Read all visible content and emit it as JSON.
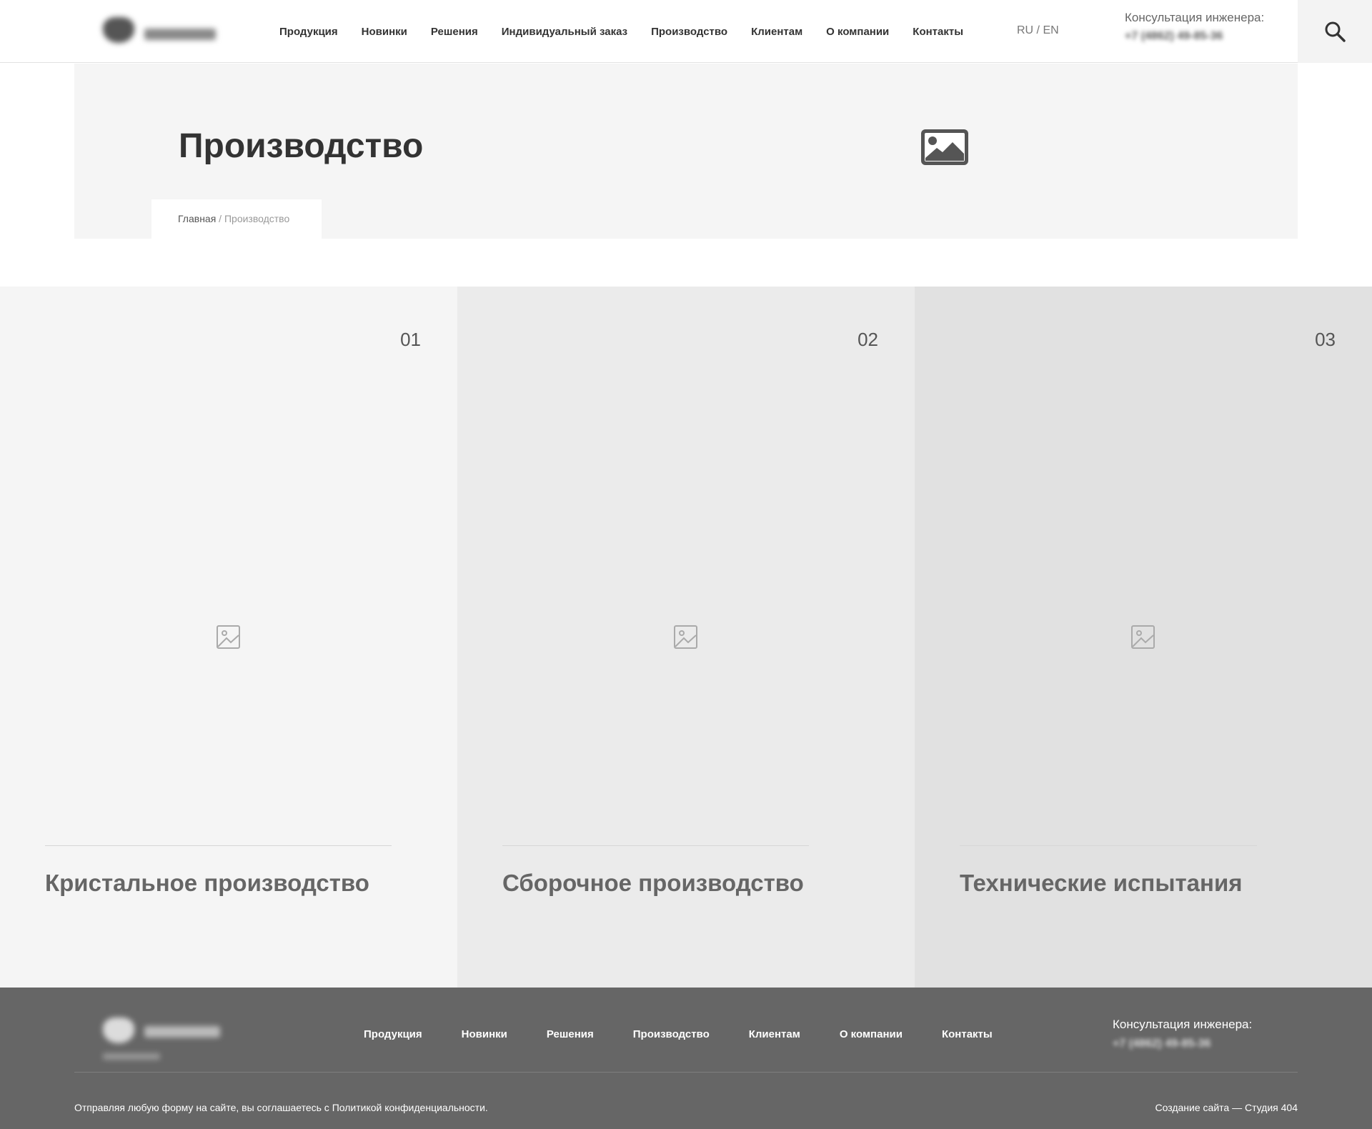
{
  "header": {
    "nav": [
      "Продукция",
      "Новинки",
      "Решения",
      "Индивидуальный заказ",
      "Производство",
      "Клиентам",
      "О компании",
      "Контакты"
    ],
    "lang": "RU / EN",
    "consult_label": "Консультация инженера:",
    "consult_phone": "+7 (4862) 49-85-36"
  },
  "hero": {
    "title": "Производство",
    "breadcrumb_home": "Главная",
    "breadcrumb_sep": " / ",
    "breadcrumb_current": "Производство"
  },
  "sections": [
    {
      "number": "01",
      "title": "Кристальное производство",
      "bg": "#f5f5f5"
    },
    {
      "number": "02",
      "title": "Сборочное производство",
      "bg": "#ebebeb"
    },
    {
      "number": "03",
      "title": "Технические испытания",
      "bg": "#e1e1e1"
    }
  ],
  "footer": {
    "nav": [
      "Продукция",
      "Новинки",
      "Решения",
      "Производство",
      "Клиентам",
      "О компании",
      "Контакты"
    ],
    "consult_label": "Консультация инженера:",
    "consult_phone": "+7 (4862) 49-85-36",
    "policy": "Отправляя любую форму на сайте, вы соглашаетесь с Политикой конфиденциальности.",
    "credit": "Создание сайта — Студия 404"
  },
  "icons": {
    "search": "search-icon",
    "hero_image": "image-icon",
    "card_image": "image-placeholder-icon"
  }
}
